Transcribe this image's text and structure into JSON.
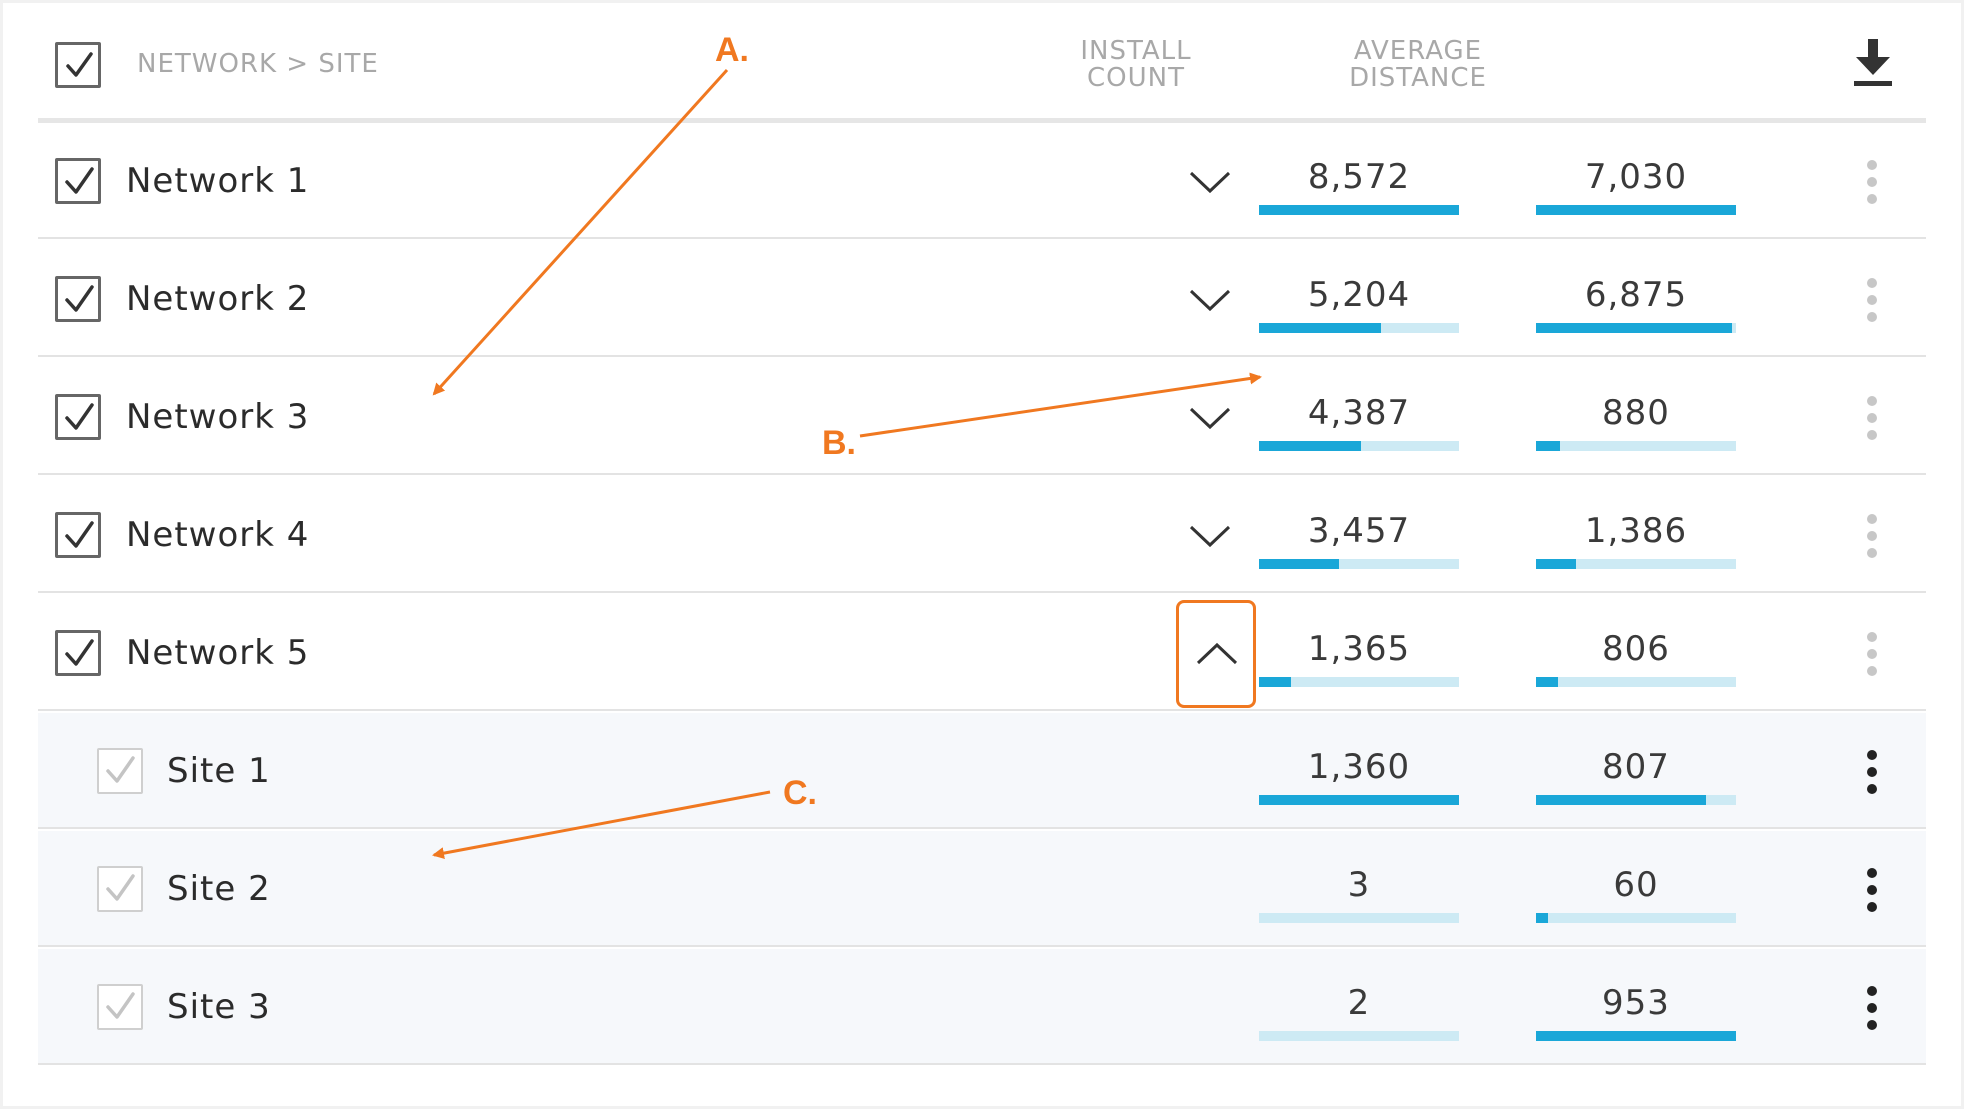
{
  "header": {
    "title": "NETWORK > SITE",
    "columns": [
      "INSTALL\nCOUNT",
      "AVERAGE\nDISTANCE"
    ],
    "install_count_lines": [
      "INSTALL",
      "COUNT"
    ],
    "average_distance_lines": [
      "AVERAGE",
      "DISTANCE"
    ],
    "select_all_checked": true
  },
  "networks": [
    {
      "label": "Network 1",
      "install": "8,572",
      "install_fill": 1.0,
      "distance": "7,030",
      "distance_fill": 1.0,
      "expanded": false
    },
    {
      "label": "Network 2",
      "install": "5,204",
      "install_fill": 0.61,
      "distance": "6,875",
      "distance_fill": 0.98,
      "expanded": false
    },
    {
      "label": "Network 3",
      "install": "4,387",
      "install_fill": 0.51,
      "distance": "880",
      "distance_fill": 0.12,
      "expanded": false
    },
    {
      "label": "Network 4",
      "install": "3,457",
      "install_fill": 0.4,
      "distance": "1,386",
      "distance_fill": 0.2,
      "expanded": false
    },
    {
      "label": "Network 5",
      "install": "1,365",
      "install_fill": 0.16,
      "distance": "806",
      "distance_fill": 0.11,
      "expanded": true
    }
  ],
  "sites": [
    {
      "label": "Site 1",
      "install": "1,360",
      "install_fill": 1.0,
      "distance": "807",
      "distance_fill": 0.85
    },
    {
      "label": "Site 2",
      "install": "3",
      "install_fill": 0.0,
      "distance": "60",
      "distance_fill": 0.06
    },
    {
      "label": "Site 3",
      "install": "2",
      "install_fill": 0.0,
      "distance": "953",
      "distance_fill": 1.0
    }
  ],
  "annotations": [
    "A.",
    "B.",
    "C."
  ],
  "colors": {
    "bar_fill": "#1aa7d8",
    "bar_track": "#cdeaf4",
    "annotation": "#f07820",
    "header_text": "#a8a8a8"
  },
  "icons": {
    "checkbox": "check-icon",
    "expand": "chevron-down-icon",
    "collapse": "chevron-up-icon",
    "menu": "kebab-menu-icon",
    "export": "download-icon"
  }
}
